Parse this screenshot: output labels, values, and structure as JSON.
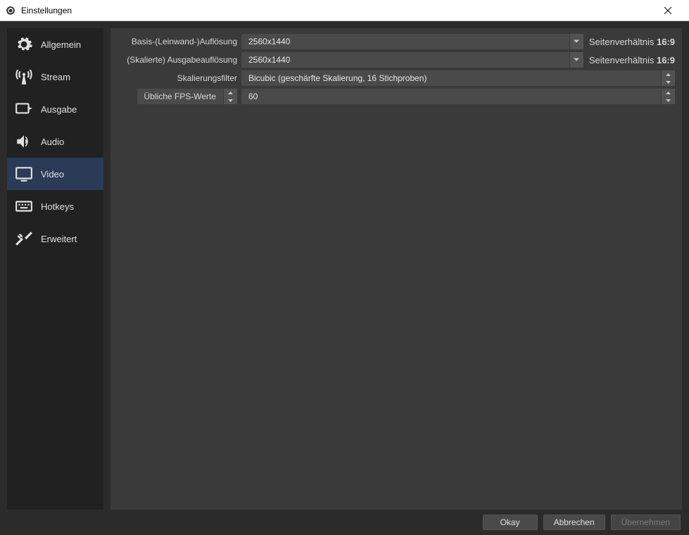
{
  "window": {
    "title": "Einstellungen"
  },
  "sidebar": {
    "items": [
      {
        "id": "allgemein",
        "label": "Allgemein"
      },
      {
        "id": "stream",
        "label": "Stream"
      },
      {
        "id": "ausgabe",
        "label": "Ausgabe"
      },
      {
        "id": "audio",
        "label": "Audio"
      },
      {
        "id": "video",
        "label": "Video"
      },
      {
        "id": "hotkeys",
        "label": "Hotkeys"
      },
      {
        "id": "erweitert",
        "label": "Erweitert"
      }
    ],
    "active": "video"
  },
  "video": {
    "base_label": "Basis-(Leinwand-)Auflösung",
    "base_value": "2560x1440",
    "base_aspect_prefix": "Seitenverhältnis ",
    "base_aspect_ratio": "16:9",
    "scaled_label": "(Skalierte) Ausgabeauflösung",
    "scaled_value": "2560x1440",
    "scaled_aspect_prefix": "Seitenverhältnis ",
    "scaled_aspect_ratio": "16:9",
    "filter_label": "Skalierungsfilter",
    "filter_value": "Bicubic (geschärfte Skalierung, 16 Stichproben)",
    "fps_type_label": "Übliche FPS-Werte",
    "fps_value": "60"
  },
  "footer": {
    "ok": "Okay",
    "cancel": "Abbrechen",
    "apply": "Übernehmen"
  }
}
